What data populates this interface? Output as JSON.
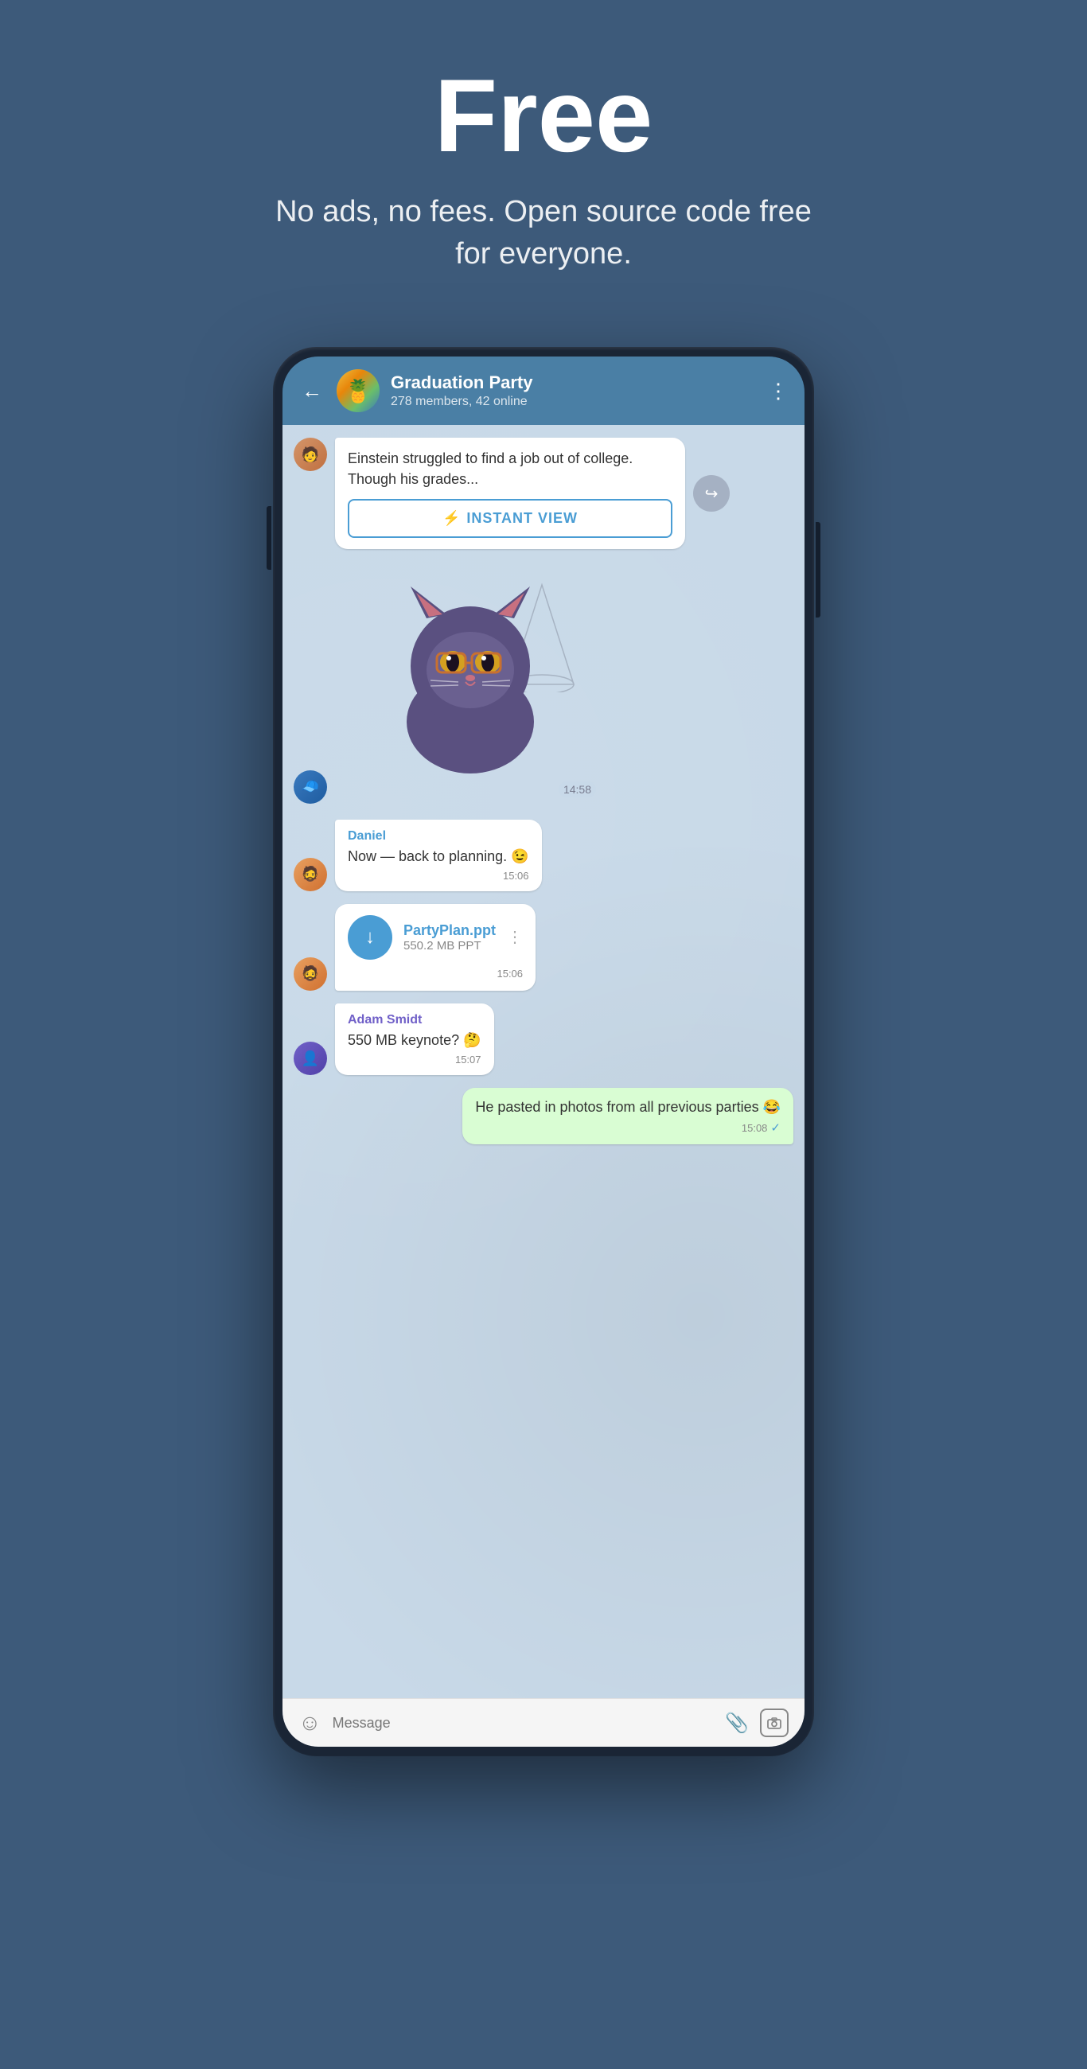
{
  "hero": {
    "title": "Free",
    "subtitle": "No ads, no fees. Open source code free for everyone."
  },
  "chat": {
    "back_label": "←",
    "group_name": "Graduation Party",
    "group_meta": "278 members, 42 online",
    "more_icon": "⋮",
    "article_text": "Einstein struggled to find a job out of college. Though his grades...",
    "instant_view_label": "INSTANT VIEW",
    "instant_view_icon": "⚡",
    "sticker_time": "14:58",
    "messages": [
      {
        "sender": "Daniel",
        "text": "Now — back to planning. 😉",
        "time": "15:06",
        "type": "incoming",
        "avatar": "user1"
      },
      {
        "sender": "",
        "file_name": "PartyPlan.ppt",
        "file_size": "550.2 MB PPT",
        "time": "15:06",
        "type": "file",
        "avatar": "user1"
      },
      {
        "sender": "Adam Smidt",
        "text": "550 MB keynote? 🤔",
        "time": "15:07",
        "type": "incoming",
        "avatar": "user2"
      },
      {
        "sender": "",
        "text": "He pasted in photos from all previous parties 😂",
        "time": "15:08",
        "check": "✓",
        "type": "outgoing"
      }
    ],
    "input_placeholder": "Message",
    "emoji_icon": "☺",
    "attach_icon": "🔗",
    "camera_icon": "⬭"
  }
}
